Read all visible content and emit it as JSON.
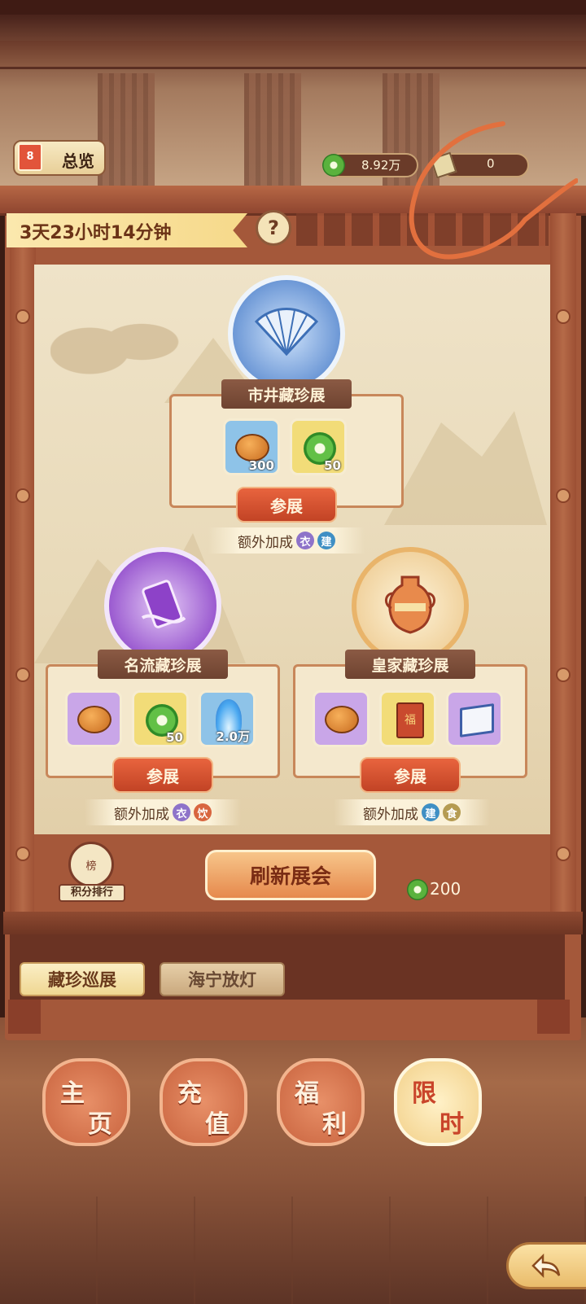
{
  "hud": {
    "overview_label": "总览",
    "coins": "8.92万",
    "tickets": "0"
  },
  "timer": "3天23小时14分钟",
  "help": "?",
  "exhibitions": [
    {
      "name": "市井藏珍展",
      "join_label": "参展",
      "bonus_label": "额外加成",
      "bonus_tags": [
        "衣",
        "建"
      ],
      "rewards": [
        {
          "icon": "meat-pie-icon",
          "count": "300"
        },
        {
          "icon": "jade-coin-icon",
          "count": "50"
        }
      ]
    },
    {
      "name": "名流藏珍展",
      "join_label": "参展",
      "bonus_label": "额外加成",
      "bonus_tags": [
        "衣",
        "饮"
      ],
      "rewards": [
        {
          "icon": "meat-pie-icon",
          "count": ""
        },
        {
          "icon": "jade-coin-icon",
          "count": "50"
        },
        {
          "icon": "blue-flame-icon",
          "count": "2.0万"
        }
      ]
    },
    {
      "name": "皇家藏珍展",
      "join_label": "参展",
      "bonus_label": "额外加成",
      "bonus_tags": [
        "建",
        "食"
      ],
      "rewards": [
        {
          "icon": "meat-pie-icon",
          "count": ""
        },
        {
          "icon": "fortune-box-icon",
          "count": ""
        },
        {
          "icon": "book-icon",
          "count": ""
        }
      ]
    }
  ],
  "rank_label": "积分排行",
  "refresh_label": "刷新展会",
  "refresh_cost": "200",
  "subtabs": [
    "藏珍巡展",
    "海宁放灯"
  ],
  "nav": [
    {
      "top": "主",
      "bottom": "页"
    },
    {
      "top": "充",
      "bottom": "值"
    },
    {
      "top": "福",
      "bottom": "利"
    },
    {
      "top": "限",
      "bottom": "时"
    }
  ],
  "tag_colors": {
    "衣": "#8e73c9",
    "建": "#3f8fc4",
    "饮": "#d8653f",
    "食": "#b59b52"
  }
}
